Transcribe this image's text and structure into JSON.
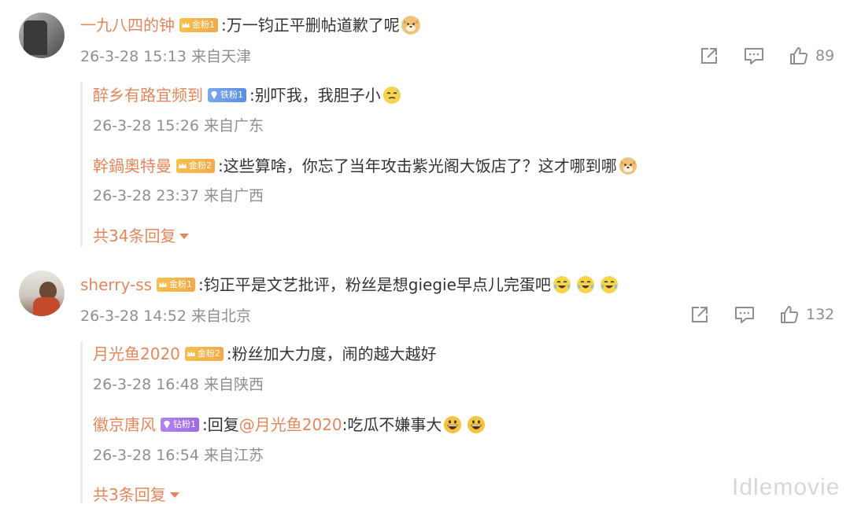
{
  "comments": [
    {
      "username": "一九八四的钟",
      "badge": "金粉1",
      "text": ":万一钧正平删帖道歉了呢",
      "emoji": [
        "doge"
      ],
      "time": "26-3-28 15:13",
      "location": "来自天津",
      "likes": "89",
      "replies": [
        {
          "username": "醉乡有路宜频到",
          "badge": "铁粉1",
          "text": ":别吓我，我胆子小",
          "emoji": [
            "sweat"
          ],
          "time": "26-3-28 15:26",
          "location": "来自广东"
        },
        {
          "username": "幹鍋奧特曼",
          "badge": "金粉2",
          "text": ":这些算啥，你忘了当年攻击紫光阁大饭店了？这才哪到哪",
          "emoji": [
            "doge"
          ],
          "time": "26-3-28 23:37",
          "location": "来自广西"
        }
      ],
      "more_replies": "共34条回复"
    },
    {
      "username": "sherry-ss",
      "badge": "金粉1",
      "text": ":钧正平是文艺批评，粉丝是想giegie早点儿完蛋吧",
      "emoji": [
        "laugh-cry",
        "laugh-cry",
        "laugh-cry"
      ],
      "time": "26-3-28 14:52",
      "location": "来自北京",
      "likes": "132",
      "replies": [
        {
          "username": "月光鱼2020",
          "badge": "金粉2",
          "text": ":粉丝加大力度，闹的越大越好",
          "emoji": [],
          "time": "26-3-28 16:48",
          "location": "来自陕西"
        },
        {
          "username": "徽京唐风",
          "badge": "钻粉1",
          "text_prefix": ":回复",
          "mention": "@月光鱼2020",
          "text": ":吃瓜不嫌事大",
          "emoji": [
            "grin",
            "grin"
          ],
          "time": "26-3-28 16:54",
          "location": "来自江苏"
        }
      ],
      "more_replies": "共3条回复"
    }
  ],
  "watermark": "Idlemovie",
  "colors": {
    "username": "#e5875a",
    "meta": "#8f8f8f",
    "text": "#333333",
    "badge_gold": "#f4b84a",
    "badge_iron": "#6b9be8",
    "badge_diamond": "#a576ea"
  }
}
